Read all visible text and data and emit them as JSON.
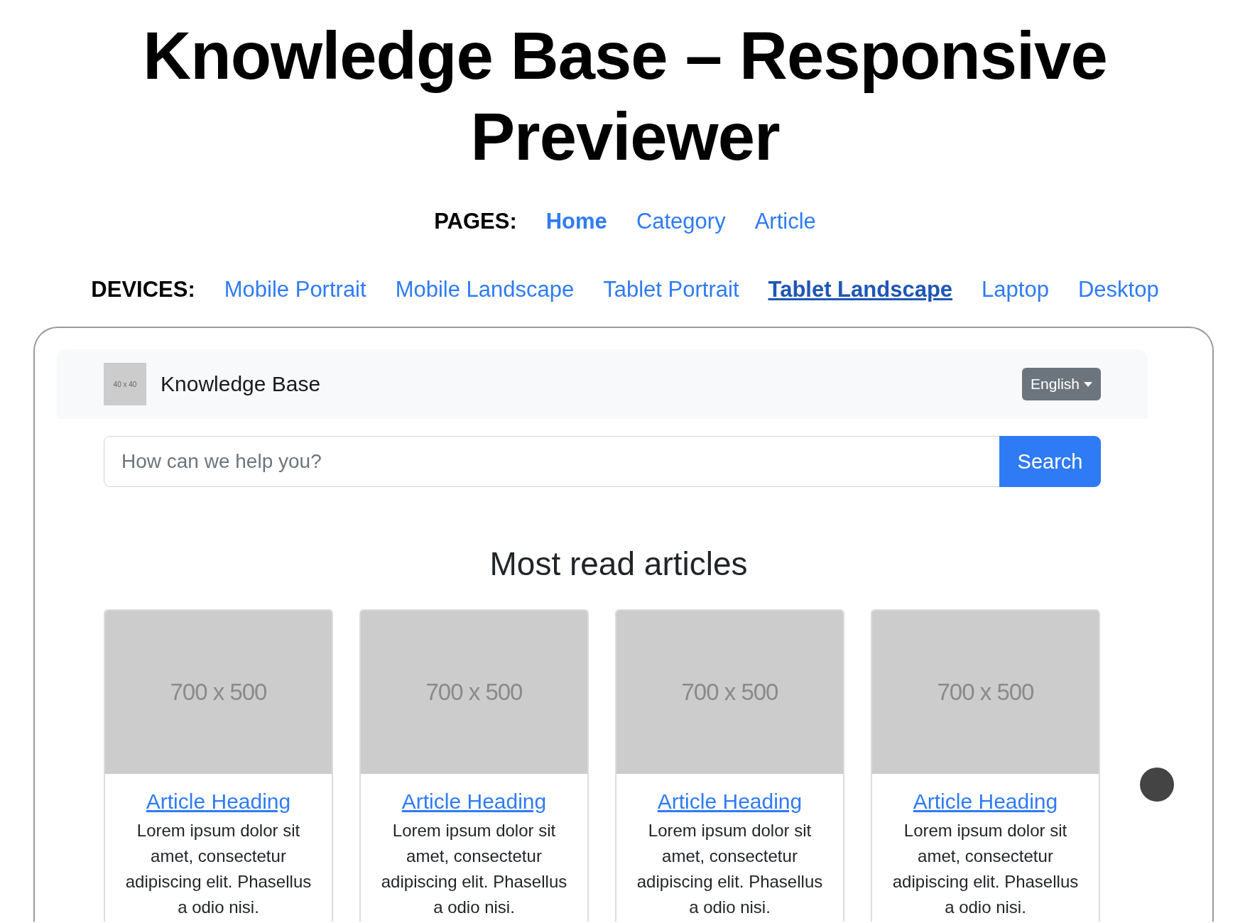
{
  "title": "Knowledge Base – Responsive Previewer",
  "pages": {
    "label": "PAGES:",
    "links": [
      {
        "label": "Home",
        "selected": true
      },
      {
        "label": "Category",
        "selected": false
      },
      {
        "label": "Article",
        "selected": false
      }
    ]
  },
  "devices": {
    "label": "DEVICES:",
    "links": [
      {
        "label": "Mobile Portrait",
        "selected": false
      },
      {
        "label": "Mobile Landscape",
        "selected": false
      },
      {
        "label": "Tablet Portrait",
        "selected": false
      },
      {
        "label": "Tablet Landscape",
        "selected": true
      },
      {
        "label": "Laptop",
        "selected": false
      },
      {
        "label": "Desktop",
        "selected": false
      }
    ]
  },
  "preview": {
    "navbar": {
      "logo": "40 x 40",
      "brand": "Knowledge Base",
      "language": "English"
    },
    "search": {
      "placeholder": "How can we help you?",
      "button": "Search"
    },
    "section_title": "Most read articles",
    "articles": [
      {
        "image": "700 x 500",
        "heading": "Article Heading",
        "summary": "Lorem ipsum dolor sit amet, consectetur adipiscing elit. Phasellus a odio nisi."
      },
      {
        "image": "700 x 500",
        "heading": "Article Heading",
        "summary": "Lorem ipsum dolor sit amet, consectetur adipiscing elit. Phasellus a odio nisi."
      },
      {
        "image": "700 x 500",
        "heading": "Article Heading",
        "summary": "Lorem ipsum dolor sit amet, consectetur adipiscing elit. Phasellus a odio nisi."
      },
      {
        "image": "700 x 500",
        "heading": "Article Heading",
        "summary": "Lorem ipsum dolor sit amet, consectetur adipiscing elit. Phasellus a odio nisi."
      }
    ]
  }
}
